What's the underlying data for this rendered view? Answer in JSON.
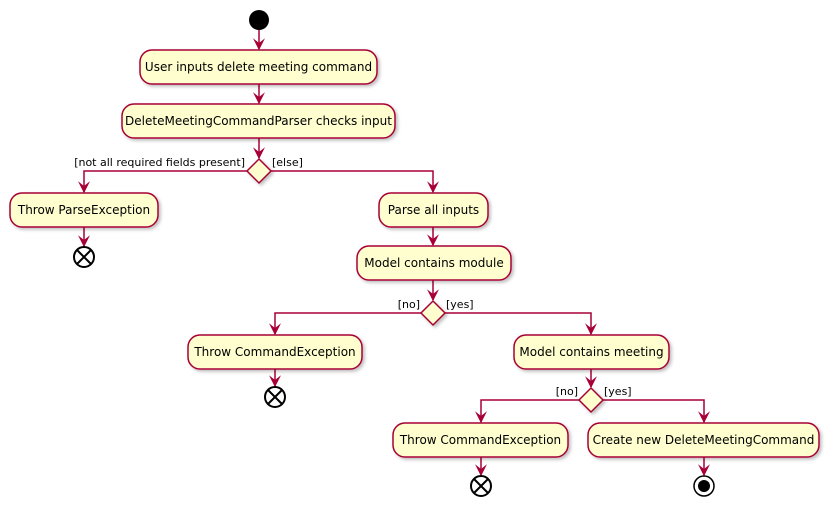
{
  "colors": {
    "fill": "#FEFECE",
    "border": "#A80036",
    "arrow": "#A80036"
  },
  "activities": {
    "a1": "User inputs delete meeting command",
    "a2": "DeleteMeetingCommandParser checks input",
    "a3": "Throw ParseException",
    "a4": "Parse all inputs",
    "a5": "Model contains module",
    "a6": "Throw CommandException",
    "a7": "Model contains meeting",
    "a8": "Throw CommandException",
    "a9": "Create new DeleteMeetingCommand"
  },
  "guards": {
    "d1_left": "[not all required fields present]",
    "d1_right": "[else]",
    "d2_left": "[no]",
    "d2_right": "[yes]",
    "d3_left": "[no]",
    "d3_right": "[yes]"
  }
}
